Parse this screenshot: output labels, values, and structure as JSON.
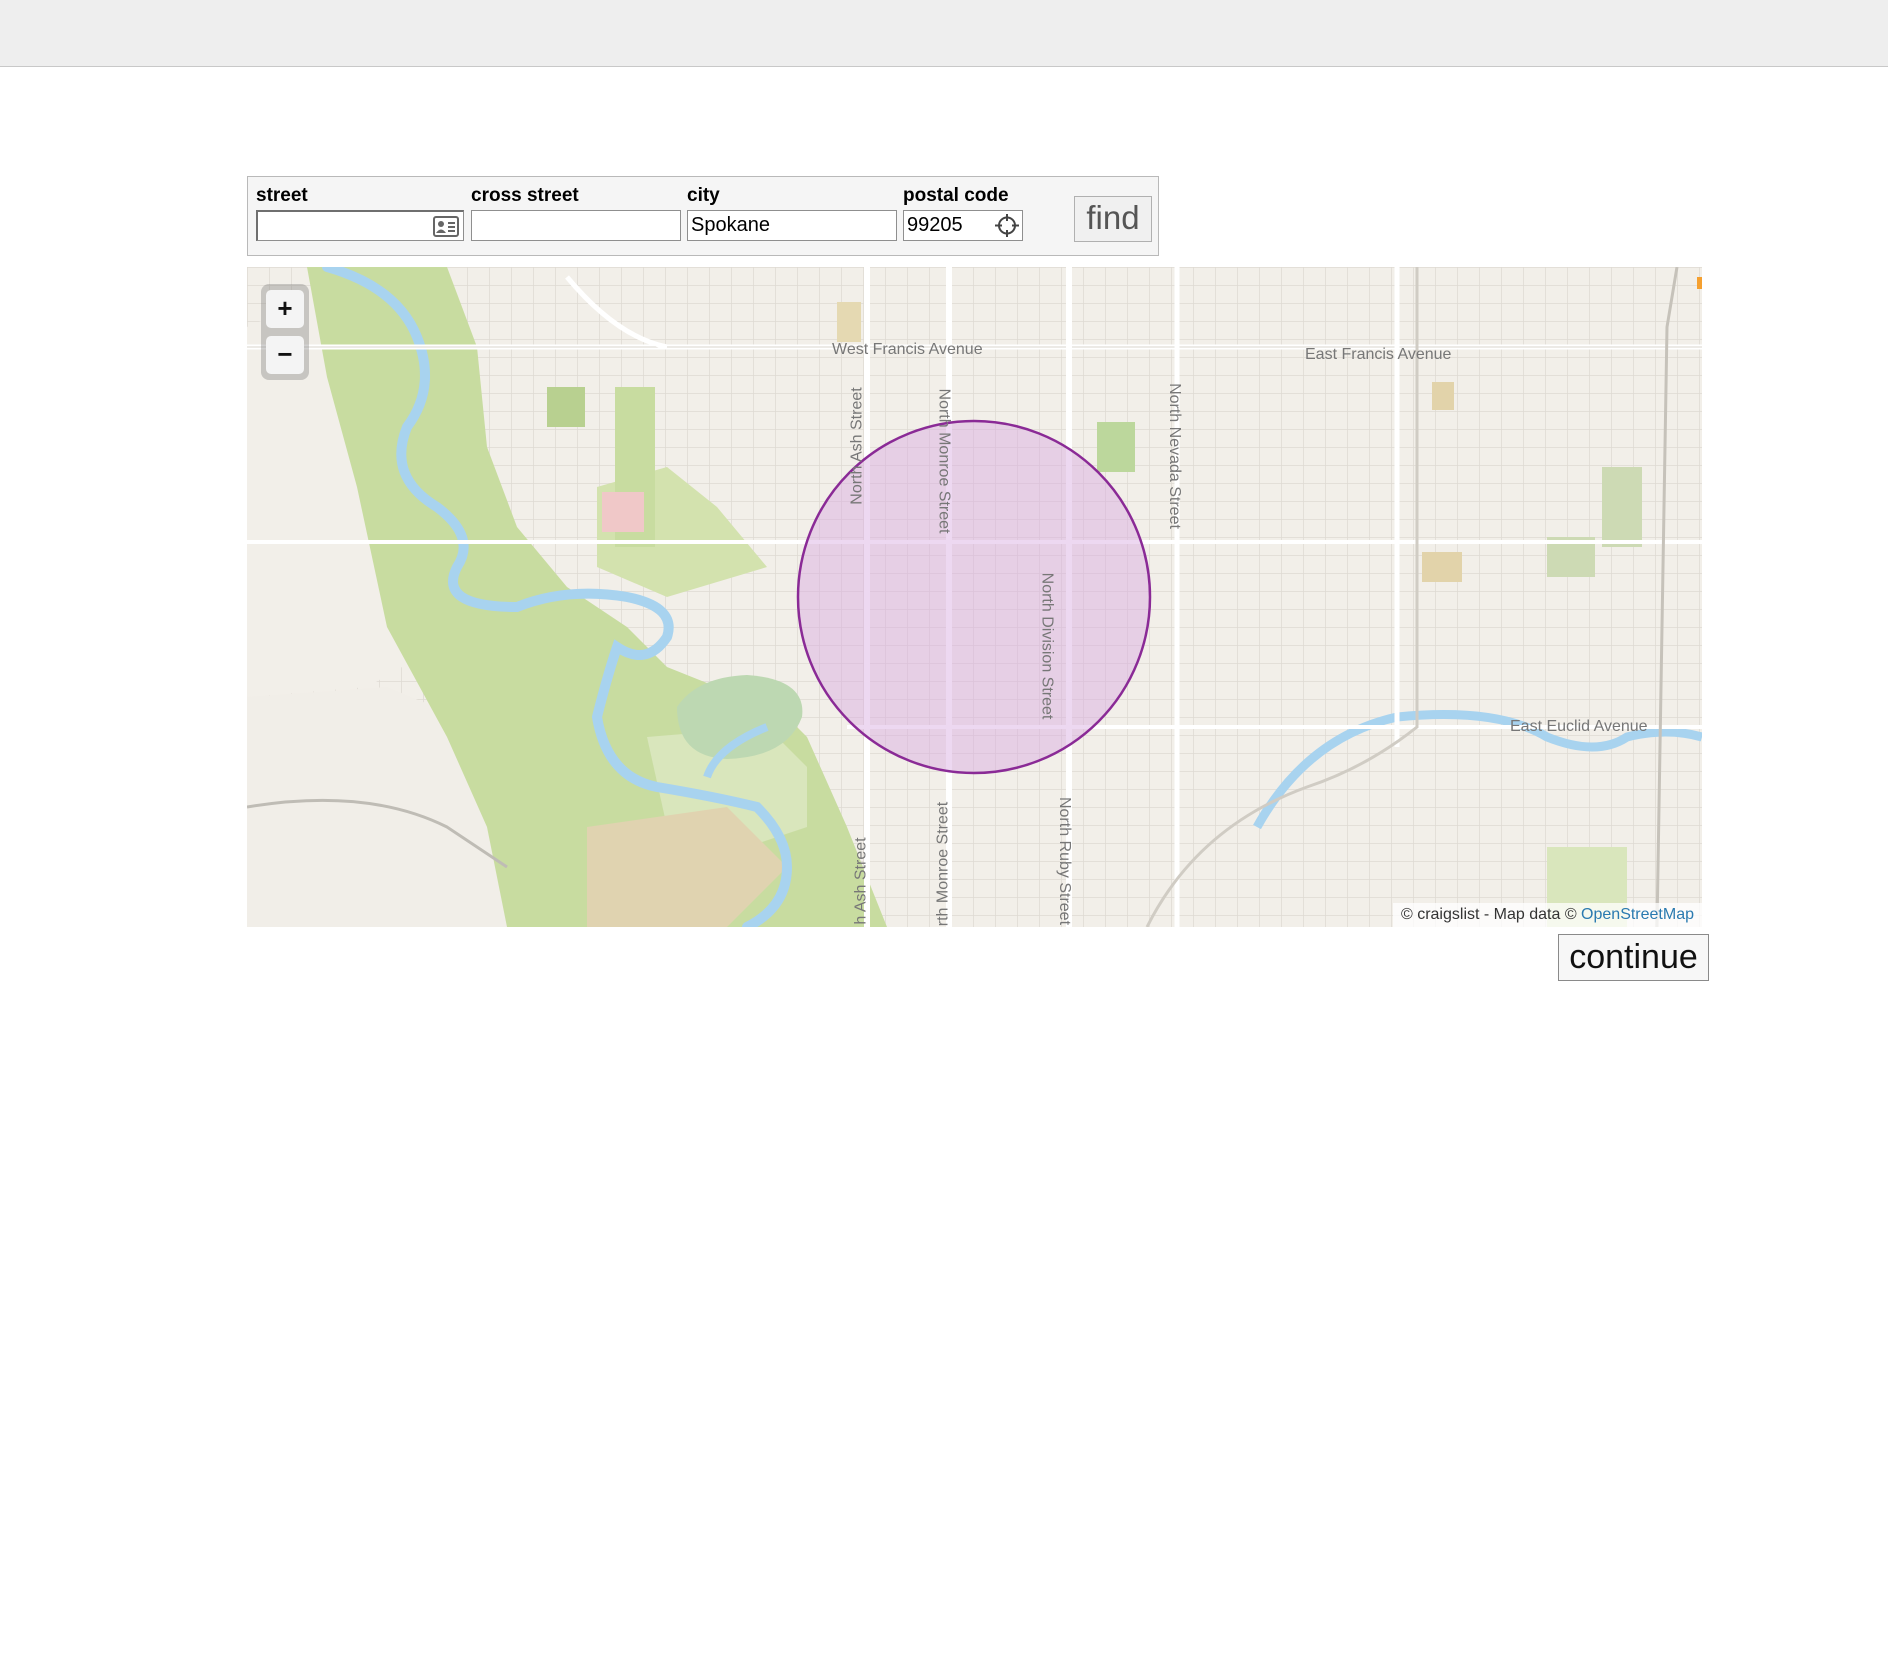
{
  "address_form": {
    "street": {
      "label": "street",
      "value": "",
      "placeholder": ""
    },
    "cross_street": {
      "label": "cross street",
      "value": "",
      "placeholder": ""
    },
    "city": {
      "label": "city",
      "value": "Spokane",
      "placeholder": ""
    },
    "postal_code": {
      "label": "postal code",
      "value": "99205",
      "placeholder": ""
    },
    "find_label": "find"
  },
  "map": {
    "zoom_in": "+",
    "zoom_out": "−",
    "radius_color": "#9b2fa0",
    "street_labels": {
      "west_francis": "West Francis Avenue",
      "east_francis": "East Francis Avenue",
      "north_ash_top": "North Ash Street",
      "north_monroe_top": "North Monroe Street",
      "north_nevada": "North Nevada Street",
      "north_division": "North Division Street",
      "east_euclid": "East Euclid Avenue",
      "north_ash_bottom": "h Ash Street",
      "north_monroe_bottom": "rth Monroe Street",
      "north_ruby": "North Ruby Street"
    },
    "attribution_prefix": "© craigslist - Map data © ",
    "attribution_link": "OpenStreetMap"
  },
  "continue_label": "continue",
  "icons": {
    "contact_card": "contact-card-icon",
    "locate": "crosshair-icon"
  }
}
